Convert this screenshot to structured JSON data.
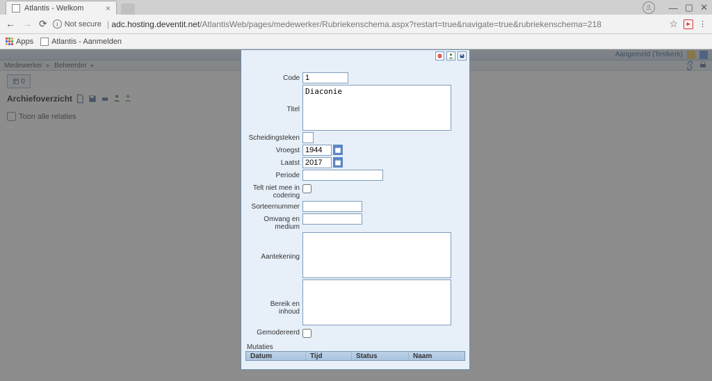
{
  "browser": {
    "tab_title": "Atlantis - Welkom",
    "security_label": "Not secure",
    "url_host": "adc.hosting.deventit.net",
    "url_path": "/AtlantisWeb/pages/medewerker/Rubriekenschema.aspx?restart=true&navigate=true&rubriekenschema=218",
    "apps_label": "Apps",
    "bookmark1": "Atlantis - Aanmelden",
    "window": {
      "minimize": "—",
      "maximize": "▢",
      "close": "✕"
    }
  },
  "app": {
    "logged_in_label": "Aangemeld (Testkerk)",
    "menu": {
      "item1": "Medewerker",
      "item2": "Beheerder"
    },
    "badge_count": "0",
    "page_title": "Archiefoverzicht",
    "show_all_relations": "Toon alle relaties"
  },
  "form": {
    "labels": {
      "code": "Code",
      "titel": "Titel",
      "scheidingsteken": "Scheidingsteken",
      "vroegst": "Vroegst",
      "laatst": "Laatst",
      "periode": "Periode",
      "telt_niet_mee": "Telt niet mee in codering",
      "sorteernummer": "Sorteernummer",
      "omvang": "Omvang en medium",
      "aantekening": "Aantekening",
      "bereik": "Bereik en inhoud",
      "gemodereerd": "Gemodereerd"
    },
    "values": {
      "code": "1",
      "titel": "Diaconie",
      "scheidingsteken": "",
      "vroegst": "1944",
      "laatst": "2017",
      "periode": "",
      "sorteernummer": "",
      "omvang": "",
      "aantekening": "",
      "bereik": ""
    },
    "mutaties_label": "Mutaties",
    "columns": {
      "datum": "Datum",
      "tijd": "Tijd",
      "status": "Status",
      "naam": "Naam"
    }
  }
}
